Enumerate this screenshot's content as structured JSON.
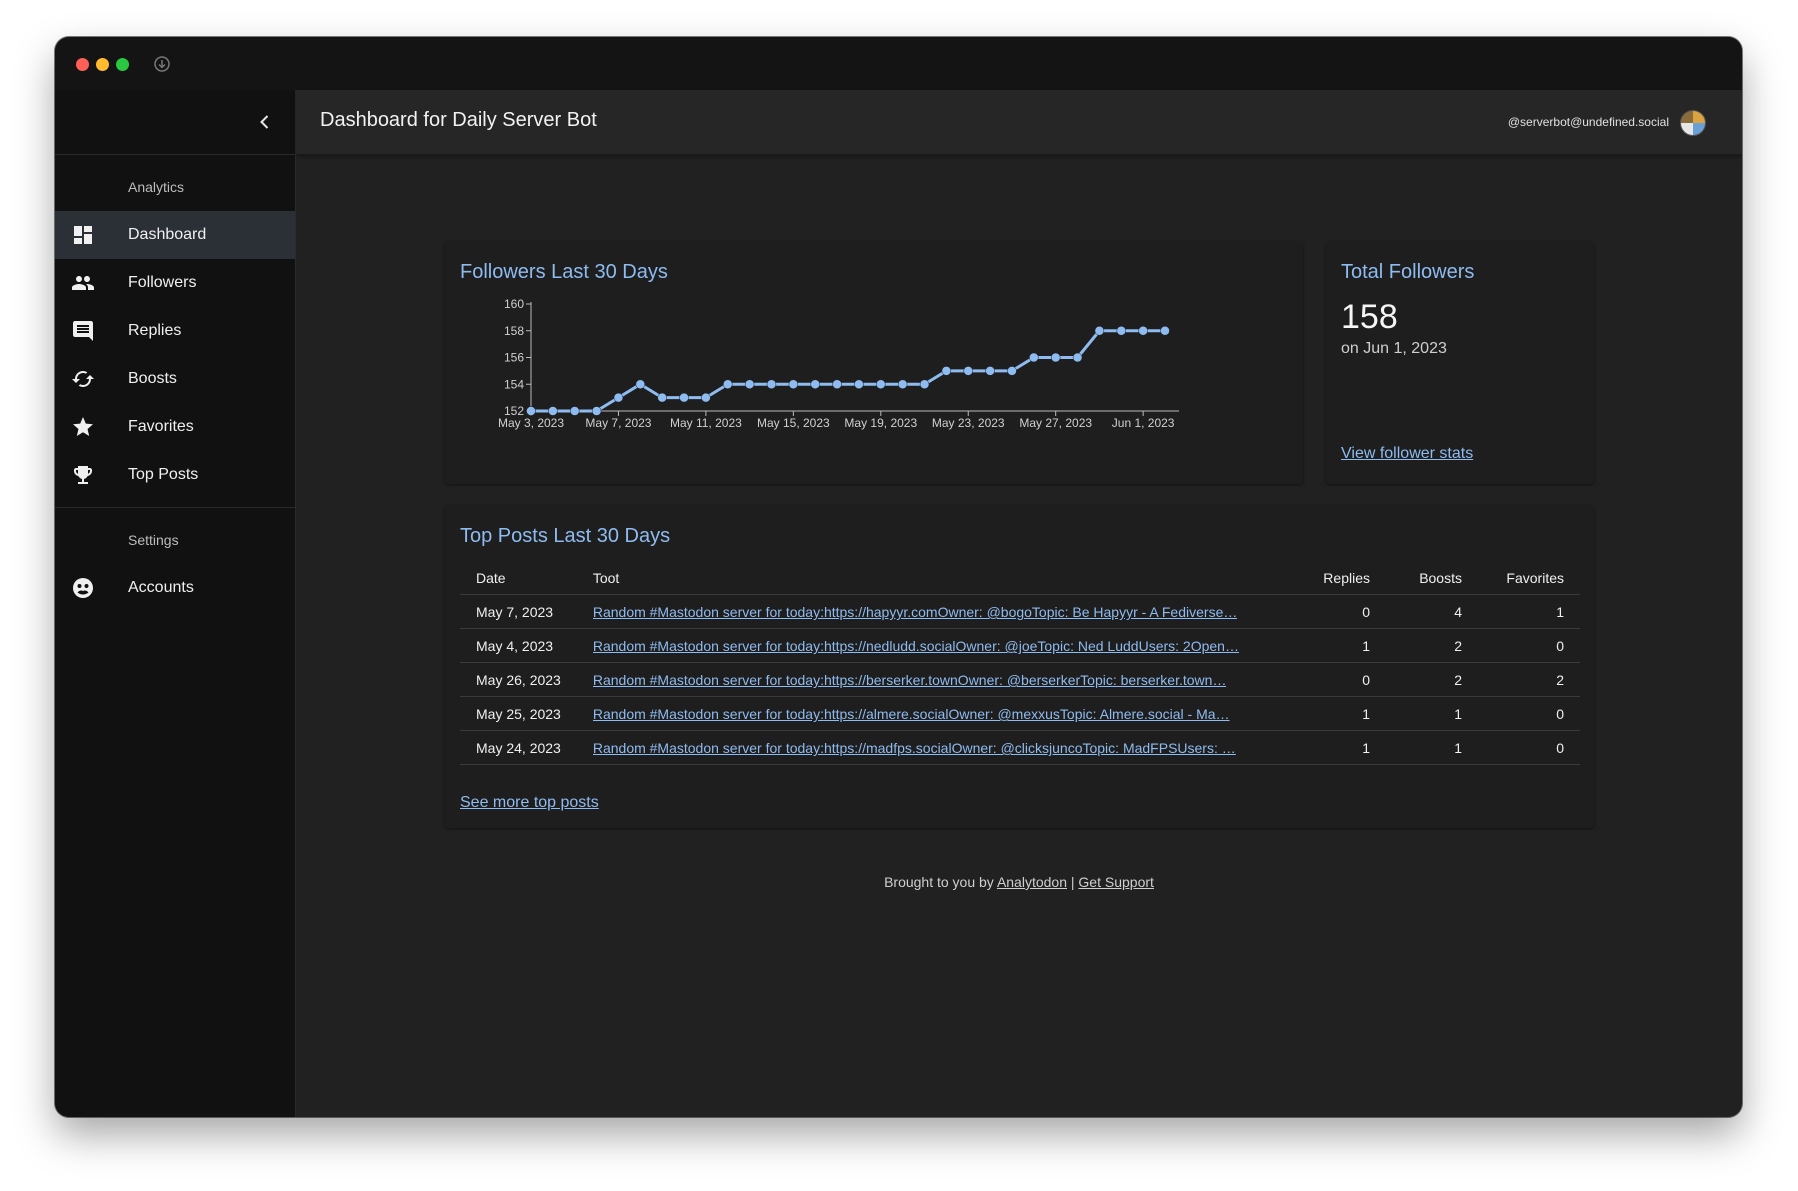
{
  "header": {
    "title": "Dashboard for Daily Server Bot",
    "account": "@serverbot@undefined.social"
  },
  "sidebar": {
    "analytics_label": "Analytics",
    "settings_label": "Settings",
    "items": [
      {
        "label": "Dashboard",
        "icon": "dashboard-icon"
      },
      {
        "label": "Followers",
        "icon": "people-icon"
      },
      {
        "label": "Replies",
        "icon": "comment-icon"
      },
      {
        "label": "Boosts",
        "icon": "boost-icon"
      },
      {
        "label": "Favorites",
        "icon": "star-icon"
      },
      {
        "label": "Top Posts",
        "icon": "trophy-icon"
      }
    ],
    "settings_items": [
      {
        "label": "Accounts",
        "icon": "account-icon"
      }
    ]
  },
  "followers_card": {
    "title": "Followers Last 30 Days"
  },
  "chart_data": {
    "type": "line",
    "title": "Followers Last 30 Days",
    "xlabel": "",
    "ylabel": "",
    "ylim": [
      152,
      160
    ],
    "yticks": [
      152,
      154,
      156,
      158,
      160
    ],
    "xtick_labels": [
      "May 3, 2023",
      "May 7, 2023",
      "May 11, 2023",
      "May 15, 2023",
      "May 19, 2023",
      "May 23, 2023",
      "May 27, 2023",
      "Jun 1, 2023"
    ],
    "xtick_index": [
      0,
      4,
      8,
      12,
      16,
      20,
      24,
      28
    ],
    "x": [
      "May 3, 2023",
      "May 4, 2023",
      "May 5, 2023",
      "May 6, 2023",
      "May 7, 2023",
      "May 8, 2023",
      "May 9, 2023",
      "May 10, 2023",
      "May 11, 2023",
      "May 12, 2023",
      "May 13, 2023",
      "May 14, 2023",
      "May 15, 2023",
      "May 16, 2023",
      "May 17, 2023",
      "May 18, 2023",
      "May 19, 2023",
      "May 20, 2023",
      "May 21, 2023",
      "May 22, 2023",
      "May 23, 2023",
      "May 24, 2023",
      "May 25, 2023",
      "May 26, 2023",
      "May 27, 2023",
      "May 28, 2023",
      "May 29, 2023",
      "May 30, 2023",
      "May 31, 2023",
      "Jun 1, 2023"
    ],
    "values": [
      152,
      152,
      152,
      152,
      153,
      154,
      153,
      153,
      153,
      154,
      154,
      154,
      154,
      154,
      154,
      154,
      154,
      154,
      154,
      155,
      155,
      155,
      155,
      156,
      156,
      156,
      158,
      158,
      158,
      158
    ],
    "color": "#8ebbf0",
    "grid": false
  },
  "total_card": {
    "title": "Total Followers",
    "value": "158",
    "date": "on Jun 1, 2023",
    "link": "View follower stats"
  },
  "posts_card": {
    "title": "Top Posts Last 30 Days",
    "columns": [
      "Date",
      "Toot",
      "Replies",
      "Boosts",
      "Favorites"
    ],
    "rows": [
      {
        "date": "May 7, 2023",
        "toot": "Random #Mastodon server for today:https://hapyyr.comOwner: @bogoTopic: Be Hapyyr - A Fediverse…",
        "replies": "0",
        "boosts": "4",
        "favorites": "1"
      },
      {
        "date": "May 4, 2023",
        "toot": "Random #Mastodon server for today:https://nedludd.socialOwner: @joeTopic: Ned LuddUsers: 2Open…",
        "replies": "1",
        "boosts": "2",
        "favorites": "0"
      },
      {
        "date": "May 26, 2023",
        "toot": "Random #Mastodon server for today:https://berserker.townOwner: @berserkerTopic: berserker.town…",
        "replies": "0",
        "boosts": "2",
        "favorites": "2"
      },
      {
        "date": "May 25, 2023",
        "toot": "Random #Mastodon server for today:https://almere.socialOwner: @mexxusTopic: Almere.social - Ma…",
        "replies": "1",
        "boosts": "1",
        "favorites": "0"
      },
      {
        "date": "May 24, 2023",
        "toot": "Random #Mastodon server for today:https://madfps.socialOwner: @clicksjuncoTopic: MadFPSUsers: …",
        "replies": "1",
        "boosts": "1",
        "favorites": "0"
      }
    ],
    "more_link": "See more top posts"
  },
  "footer": {
    "prefix": "Brought to you by",
    "brand_link": "Analytodon",
    "separator": "|",
    "support_link": "Get Support"
  }
}
